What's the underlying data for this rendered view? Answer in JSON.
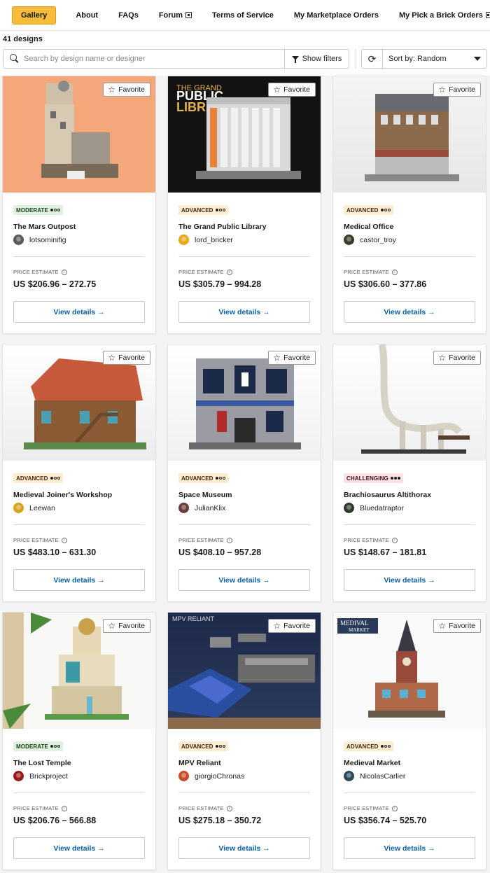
{
  "nav": {
    "items": [
      {
        "label": "Gallery",
        "active": true
      },
      {
        "label": "About"
      },
      {
        "label": "FAQs"
      },
      {
        "label": "Forum"
      },
      {
        "label": "Terms of Service"
      },
      {
        "label": "My Marketplace Orders"
      },
      {
        "label": "My Pick a Brick Orders"
      }
    ]
  },
  "gallery": {
    "count": "41 designs",
    "search_placeholder": "Search by design name or designer",
    "filters_label": "Show filters",
    "sort_label": "Sort by: Random"
  },
  "card_common": {
    "favorite_label": "Favorite",
    "price_label": "PRICE ESTIMATE",
    "view_label": "View details →"
  },
  "cards": [
    {
      "title": "The Mars Outpost",
      "designer": "lotsominifig",
      "difficulty": "MODERATE",
      "price": "US $206.96 – 272.75",
      "thumb_text": "",
      "avatar_color": "#5a5a5a"
    },
    {
      "title": "The Grand Public Library",
      "designer": "lord_bricker",
      "difficulty": "ADVANCED",
      "price": "US $305.79 – 994.28",
      "thumb_text": "THE GRAND PUBLIC LIBRARY",
      "avatar_color": "#e8a917"
    },
    {
      "title": "Medical Office",
      "designer": "castor_troy",
      "difficulty": "ADVANCED",
      "price": "US $306.60 – 377.86",
      "thumb_text": "",
      "avatar_color": "#3b3b2a"
    },
    {
      "title": "Medieval Joiner's Workshop",
      "designer": "Leewan",
      "difficulty": "ADVANCED",
      "price": "US $483.10 – 631.30",
      "thumb_text": "",
      "avatar_color": "#d9a21e"
    },
    {
      "title": "Space Museum",
      "designer": "JulianKlix",
      "difficulty": "ADVANCED",
      "price": "US $408.10 – 957.28",
      "thumb_text": "",
      "avatar_color": "#6b3a3a"
    },
    {
      "title": "Brachiosaurus Altithorax",
      "designer": "Bluedatraptor",
      "difficulty": "CHALLENGING",
      "price": "US $148.67 – 181.81",
      "thumb_text": "",
      "avatar_color": "#2d3a2d"
    },
    {
      "title": "The Lost Temple",
      "designer": "Brickproject",
      "difficulty": "MODERATE",
      "price": "US $206.76 – 566.88",
      "thumb_text": "",
      "avatar_color": "#9a1b1b"
    },
    {
      "title": "MPV Reliant",
      "designer": "giorgioChronas",
      "difficulty": "ADVANCED",
      "price": "US $275.18 – 350.72",
      "thumb_text": "MPV RELIANT",
      "avatar_color": "#c94c2a"
    },
    {
      "title": "Medieval Market",
      "designer": "NicolasCarlier",
      "difficulty": "ADVANCED",
      "price": "US $356.74 – 525.70",
      "thumb_text": "MEDIVAL MARKET",
      "avatar_color": "#2a4a5a"
    }
  ]
}
